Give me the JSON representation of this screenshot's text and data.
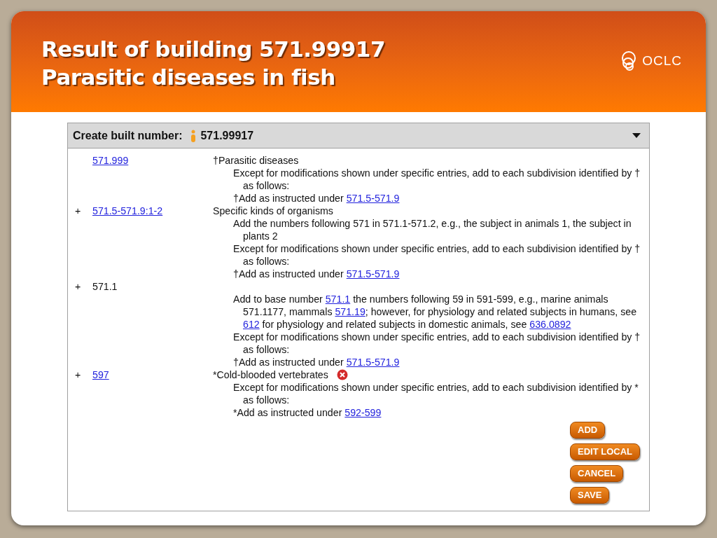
{
  "slide_title": [
    "Result of building 571.99917",
    "Parasitic diseases in fish"
  ],
  "logo": {
    "text": "OCLC"
  },
  "panel": {
    "label": "Create built number:",
    "value": "571.99917"
  },
  "entries": [
    {
      "number": "571.999",
      "link": true,
      "heading": "†Parasitic diseases",
      "flagged": false,
      "notes": [
        [
          {
            "text": "Except for modifications shown under specific entries, add to each subdivision identified by † as follows:"
          }
        ],
        [
          {
            "text": "†Add as instructed under "
          },
          {
            "link": "571.5-571.9"
          }
        ]
      ]
    },
    {
      "expand": "+",
      "number": "571.5-571.9:1-2",
      "link": true,
      "heading": "Specific kinds of organisms",
      "flagged": false,
      "notes": [
        [
          {
            "text": "Add the numbers following 571 in 571.1-571.2, e.g., the subject in animals 1, the subject in plants 2"
          }
        ],
        [
          {
            "text": "Except for modifications shown under specific entries, add to each subdivision identified by † as follows:"
          }
        ],
        [
          {
            "text": "†Add as instructed under "
          },
          {
            "link": "571.5-571.9"
          }
        ]
      ]
    },
    {
      "expand": "+",
      "number": "571.1",
      "link": false,
      "flagged": false,
      "notes": [
        [
          {
            "text": "Add to base number "
          },
          {
            "link": "571.1"
          },
          {
            "text": " the numbers following 59 in 591-599, e.g., marine animals 571.1177, mammals "
          },
          {
            "link": "571.19"
          },
          {
            "text": "; however, for physiology and related subjects in humans, see "
          },
          {
            "link": "612"
          },
          {
            "text": " for physiology and related subjects in domestic animals, see "
          },
          {
            "link": "636.0892"
          }
        ],
        [
          {
            "text": "Except for modifications shown under specific entries, add to each subdivision identified by † as follows:"
          }
        ],
        [
          {
            "text": "†Add as instructed under "
          },
          {
            "link": "571.5-571.9"
          }
        ]
      ]
    },
    {
      "expand": "+",
      "number": "597",
      "link": true,
      "heading": "*Cold-blooded vertebrates",
      "flagged": true,
      "notes": [
        [
          {
            "text": "Except for modifications shown under specific entries, add to each subdivision identified by * as follows:"
          }
        ],
        [
          {
            "text": "*Add as instructed under "
          },
          {
            "link": "592-599"
          }
        ]
      ]
    }
  ],
  "buttons": [
    "ADD",
    "EDIT LOCAL",
    "CANCEL",
    "SAVE"
  ]
}
